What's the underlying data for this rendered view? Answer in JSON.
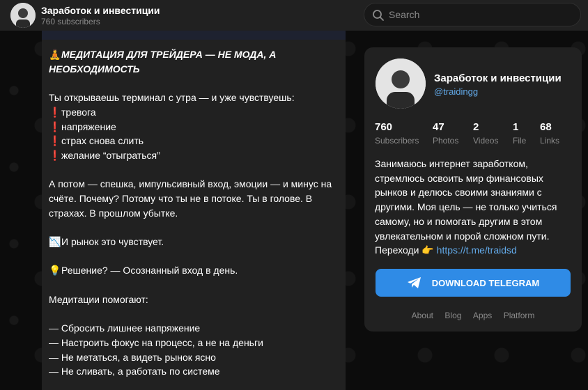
{
  "header": {
    "title": "Заработок и инвестиции",
    "subtitle": "760 subscribers",
    "search_placeholder": "Search"
  },
  "post": {
    "heading_emoji": "🧘",
    "heading": "МЕДИТАЦИЯ ДЛЯ ТРЕЙДЕРА — НЕ МОДА, А НЕОБХОДИМОСТЬ",
    "intro": "Ты открываешь терминал с утра — и уже чувствуешь:",
    "feelings": [
      "тревога",
      "напряжение",
      "страх снова слить",
      "желание “отыграться”"
    ],
    "feelings_marker": "❗",
    "paragraph2": "А потом — спешка, импульсивный вход, эмоции — и минус на счёте. Почему? Потому что ты не в потоке. Ты в голове. В страхах. В прошлом убытке.",
    "market_emoji": "📉",
    "market_line": "И рынок это чувствует.",
    "solution_emoji": "💡",
    "solution_line": "Решение? — Осознанный вход в день.",
    "help_title": "Медитации помогают:",
    "help_items": [
      "— Сбросить лишнее напряжение",
      "— Настроить фокус на процесс, а не на деньги",
      "— Не метаться, а видеть рынок ясно",
      "— Не сливать, а работать по системе"
    ]
  },
  "channel": {
    "name": "Заработок и инвестиции",
    "handle": "@traidingg",
    "stats": [
      {
        "value": "760",
        "label": "Subscribers"
      },
      {
        "value": "47",
        "label": "Photos"
      },
      {
        "value": "2",
        "label": "Videos"
      },
      {
        "value": "1",
        "label": "File"
      },
      {
        "value": "68",
        "label": "Links"
      }
    ],
    "description": "Занимаюсь интернет заработком, стремлюсь освоить мир финансовых рынков и делюсь своими знаниями с другими. Моя цель — не только учиться самому, но и помогать другим в этом увлекательном и порой сложном пути. Переходи",
    "description_emoji": "👉",
    "link": "https://t.me/traidsd",
    "download_label": "DOWNLOAD TELEGRAM",
    "footer_links": [
      "About",
      "Blog",
      "Apps",
      "Platform"
    ]
  },
  "colors": {
    "accent": "#2f8be6",
    "link": "#62a9e8",
    "panel": "#212121",
    "muted": "#8a8a8a",
    "alert": "#e53935"
  },
  "icons": [
    "search-icon",
    "telegram-plane-icon",
    "meditation-emoji",
    "exclamation-emoji",
    "chart-down-emoji",
    "bulb-emoji",
    "point-right-emoji"
  ]
}
